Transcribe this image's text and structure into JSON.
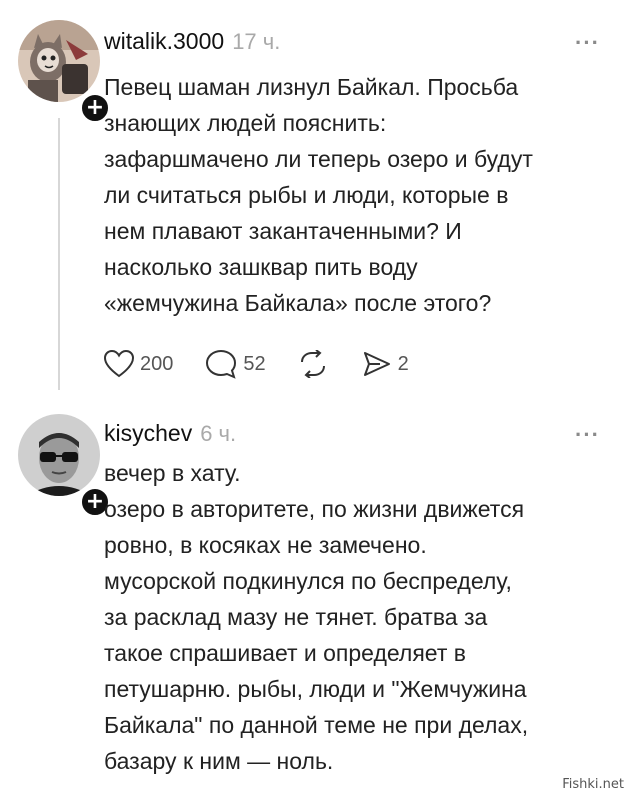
{
  "posts": [
    {
      "username": "witalik.3000",
      "time": "17 ч.",
      "more": "···",
      "follow": "+",
      "text": "Певец шаман лизнул Байкал. Просьба\nзнающих людей пояснить:\nзафаршмачено ли теперь озеро и будут\nли считаться рыбы и люди, которые в\nнем плавают закантаченными? И\nнасколько зашквар пить воду\n«жемчужина Байкала» после этого?",
      "actions": {
        "likes": "200",
        "comments": "52",
        "shares": "2"
      }
    },
    {
      "username": "kisychev",
      "time": "6 ч.",
      "more": "···",
      "follow": "+",
      "text": "вечер в хату.\nозеро в авторитете, по жизни движется\nровно, в косяках не замечено.\nмусорской подкинулся по беспределу,\nза расклад мазу не тянет. братва за\nтакое спрашивает и определяет в\nпетушарню. рыбы, люди и \"Жемчужина\nБайкала\" по данной теме не при делах,\nбазару к ним — ноль."
    }
  ],
  "watermark": "Fishki.net",
  "icons": {
    "like": "heart-icon",
    "comment": "comment-bubble-icon",
    "repost": "repost-icon",
    "share": "send-icon"
  }
}
